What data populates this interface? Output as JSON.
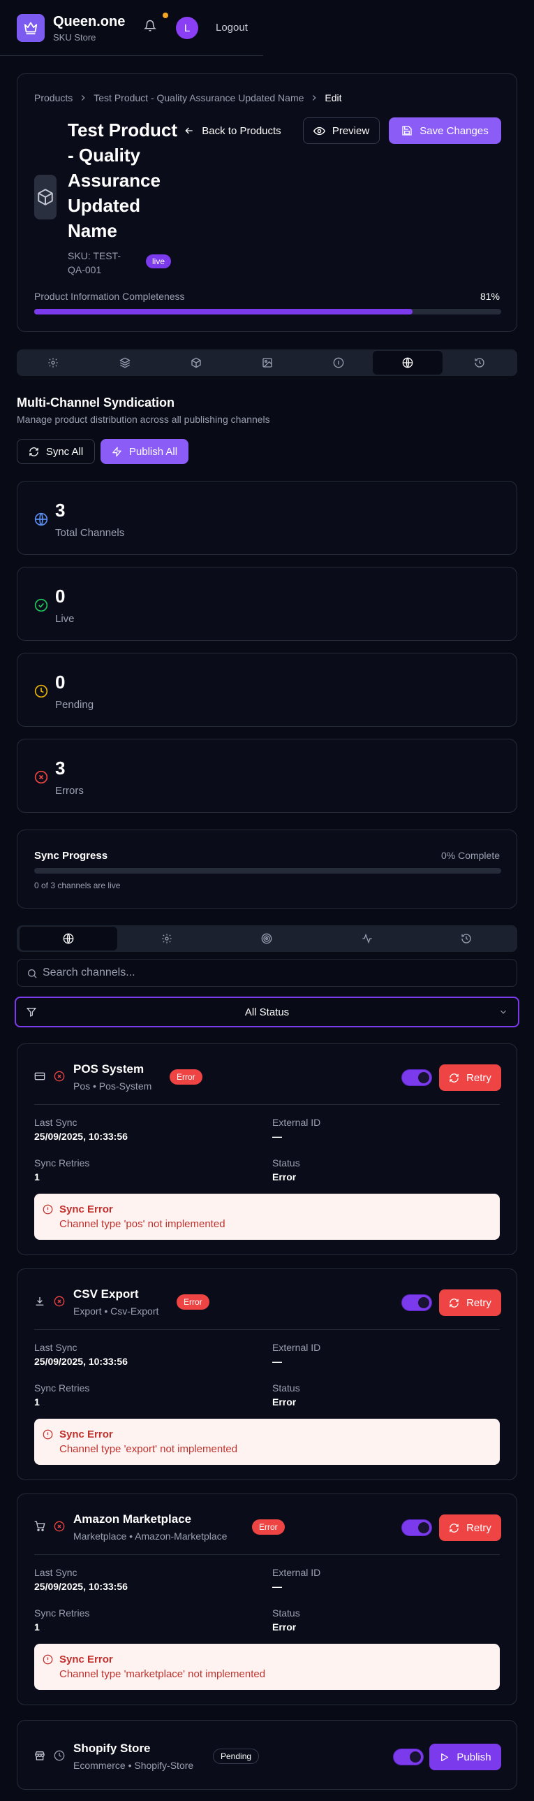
{
  "header": {
    "brand": "Queen.one",
    "sub": "SKU Store",
    "avatar": "L",
    "logout": "Logout"
  },
  "breadcrumb": {
    "products": "Products",
    "product": "Test Product - Quality Assurance Updated Name",
    "current": "Edit"
  },
  "product": {
    "title_lines": [
      "Test Product",
      "- Quality",
      "Assurance",
      "Updated",
      "Name"
    ],
    "sku_line1": "SKU: TEST-",
    "sku_line2": "QA-001",
    "status": "live",
    "back": "Back to Products",
    "preview": "Preview",
    "save": "Save Changes",
    "completeness_label": "Product Information Completeness",
    "completeness_value": "81%",
    "completeness_fraction": 0.81
  },
  "section": {
    "title": "Multi-Channel Syndication",
    "subtitle": "Manage product distribution across all publishing channels",
    "sync_all": "Sync All",
    "publish_all": "Publish All"
  },
  "stats": [
    {
      "value": "3",
      "label": "Total Channels",
      "icon": "globe-icon",
      "color": "#5b8def"
    },
    {
      "value": "0",
      "label": "Live",
      "icon": "check-circle-icon",
      "color": "#22c55e"
    },
    {
      "value": "0",
      "label": "Pending",
      "icon": "clock-icon",
      "color": "#eab308"
    },
    {
      "value": "3",
      "label": "Errors",
      "icon": "x-circle-icon",
      "color": "#ef4444"
    }
  ],
  "sync_progress": {
    "title": "Sync Progress",
    "percent_label": "0% Complete",
    "fraction": 0,
    "note": "0 of 3 channels are live"
  },
  "search": {
    "placeholder": "Search channels..."
  },
  "filter": {
    "value": "All Status"
  },
  "channels": [
    {
      "name": "POS System",
      "meta": "Pos • Pos-System",
      "badge": "Error",
      "action": "Retry",
      "last_sync_label": "Last Sync",
      "last_sync": "25/09/2025, 10:33:56",
      "external_label": "External ID",
      "external": "—",
      "retries_label": "Sync Retries",
      "retries": "1",
      "status_label": "Status",
      "status": "Error",
      "error_title": "Sync Error",
      "error_msg": "Channel type 'pos' not implemented"
    },
    {
      "name": "CSV Export",
      "meta": "Export • Csv-Export",
      "badge": "Error",
      "action": "Retry",
      "last_sync_label": "Last Sync",
      "last_sync": "25/09/2025, 10:33:56",
      "external_label": "External ID",
      "external": "—",
      "retries_label": "Sync Retries",
      "retries": "1",
      "status_label": "Status",
      "status": "Error",
      "error_title": "Sync Error",
      "error_msg": "Channel type 'export' not implemented"
    },
    {
      "name": "Amazon Marketplace",
      "meta": "Marketplace • Amazon-Marketplace",
      "badge": "Error",
      "action": "Retry",
      "last_sync_label": "Last Sync",
      "last_sync": "25/09/2025, 10:33:56",
      "external_label": "External ID",
      "external": "—",
      "retries_label": "Sync Retries",
      "retries": "1",
      "status_label": "Status",
      "status": "Error",
      "error_title": "Sync Error",
      "error_msg": "Channel type 'marketplace' not implemented"
    },
    {
      "name": "Shopify Store",
      "meta": "Ecommerce • Shopify-Store",
      "badge": "Pending",
      "action": "Publish"
    }
  ],
  "colors": {
    "accent": "#7c3aed",
    "error": "#ef4444",
    "background": "#080b16"
  }
}
